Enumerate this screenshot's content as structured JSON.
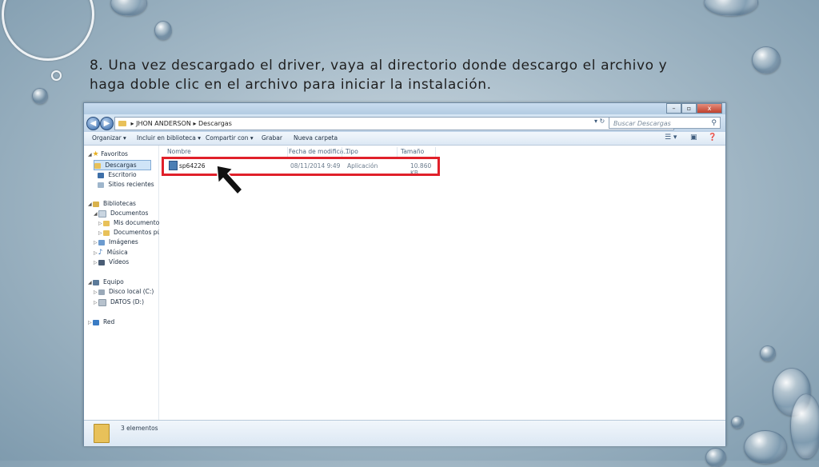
{
  "caption": {
    "line1": "8. Una vez descargado el driver, vaya al directorio donde descargo el archivo y",
    "line2": "haga doble clic en el archivo para iniciar la instalación."
  },
  "window": {
    "controls": {
      "minimize": "–",
      "maximize": "▫",
      "close": "x"
    },
    "address": {
      "back": "◀",
      "forward": "▶",
      "crumbs": [
        "JHON ANDERSON",
        "Descargas"
      ],
      "separator": "▸",
      "refresh": "▾ ↻"
    },
    "search": {
      "placeholder": "Buscar Descargas",
      "icon": "search-icon"
    },
    "toolbar": {
      "organize": "Organizar ▾",
      "include_library": "Incluir en biblioteca ▾",
      "share": "Compartir con ▾",
      "burn": "Grabar",
      "new_folder": "Nueva carpeta"
    },
    "sidebar": {
      "favorites": "Favoritos",
      "downloads": "Descargas",
      "desktop": "Escritorio",
      "recent": "Sitios recientes",
      "libraries": "Bibliotecas",
      "documents": "Documentos",
      "my_documents": "Mis documentos",
      "public_documents": "Documentos públ",
      "images": "Imágenes",
      "music": "Música",
      "videos": "Vídeos",
      "computer": "Equipo",
      "local_disk": "Disco local (C:)",
      "datos": "DATOS (D:)",
      "network": "Red"
    },
    "columns": {
      "name": "Nombre",
      "modified": "Fecha de modifica...",
      "type": "Tipo",
      "size": "Tamaño"
    },
    "files": [
      {
        "name": "sp64226",
        "modified": "08/11/2014 9:49",
        "type": "Aplicación",
        "size": "10.860 KB"
      }
    ],
    "status": {
      "count": "3 elementos"
    },
    "colors": {
      "highlight": "#e0202a",
      "selection": "#cfe4f7"
    }
  }
}
